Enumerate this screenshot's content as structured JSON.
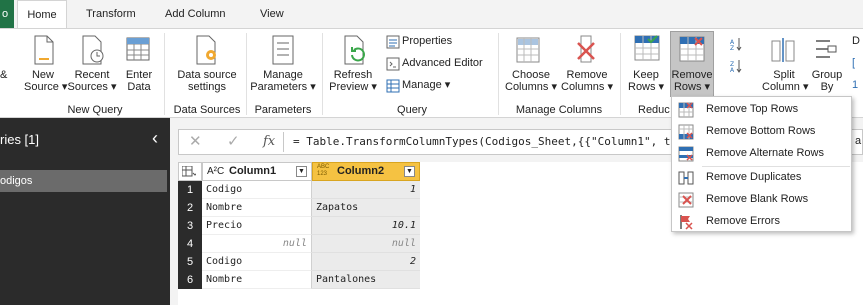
{
  "tabs": [
    "o",
    "Home",
    "Transform",
    "Add Column",
    "View"
  ],
  "ribbon": {
    "new_query": {
      "group": "New Query",
      "buttons": [
        "&",
        "New\nSource ▾",
        "Recent\nSources ▾",
        "Enter\nData"
      ]
    },
    "data_sources": {
      "group": "Data Sources",
      "button": "Data source\nsettings"
    },
    "parameters": {
      "group": "Parameters",
      "button": "Manage\nParameters ▾"
    },
    "query": {
      "group": "Query",
      "refresh": "Refresh\nPreview ▾",
      "properties": "Properties",
      "advanced_editor": "Advanced Editor",
      "manage": "Manage ▾"
    },
    "manage_columns": {
      "group": "Manage Columns",
      "choose": "Choose\nColumns ▾",
      "remove": "Remove\nColumns ▾"
    },
    "reduce_rows": {
      "group": "Reduc",
      "keep": "Keep\nRows ▾",
      "remove": "Remove\nRows ▾"
    },
    "split": "Split\nColumn ▾",
    "group_by": "Group\nBy",
    "edge_letters": [
      "D",
      "[",
      "1"
    ]
  },
  "queries": {
    "title": "ries [1]",
    "item": "odigos",
    "collapse": "‹"
  },
  "formula": {
    "cancel": "✕",
    "confirm": "✓",
    "fx": "fx",
    "text": "= Table.TransformColumnTypes(Codigos_Sheet,{{\"Column1\", t",
    "overflow": "a"
  },
  "grid": {
    "columns": [
      {
        "type": "A²C",
        "name": "Column1"
      },
      {
        "type": "ABC 123",
        "name": "Column2"
      }
    ],
    "rows": [
      {
        "n": "1",
        "c1": "Codigo",
        "c2": "1"
      },
      {
        "n": "2",
        "c1": "Nombre",
        "c2": "Zapatos"
      },
      {
        "n": "3",
        "c1": "Precio",
        "c2": "10.1"
      },
      {
        "n": "4",
        "c1": "null",
        "c2": "null"
      },
      {
        "n": "5",
        "c1": "Codigo",
        "c2": "2"
      },
      {
        "n": "6",
        "c1": "Nombre",
        "c2": "Pantalones"
      }
    ]
  },
  "menu": {
    "items": [
      "Remove Top Rows",
      "Remove Bottom Rows",
      "Remove Alternate Rows",
      "Remove Duplicates",
      "Remove Blank Rows",
      "Remove Errors"
    ]
  },
  "colors": {
    "accent_green": "#217346",
    "dark_panel": "#2b2b2b",
    "selected_col": "#f5c242",
    "remove_red": "#d9534f",
    "icon_blue": "#2f6fb3"
  }
}
